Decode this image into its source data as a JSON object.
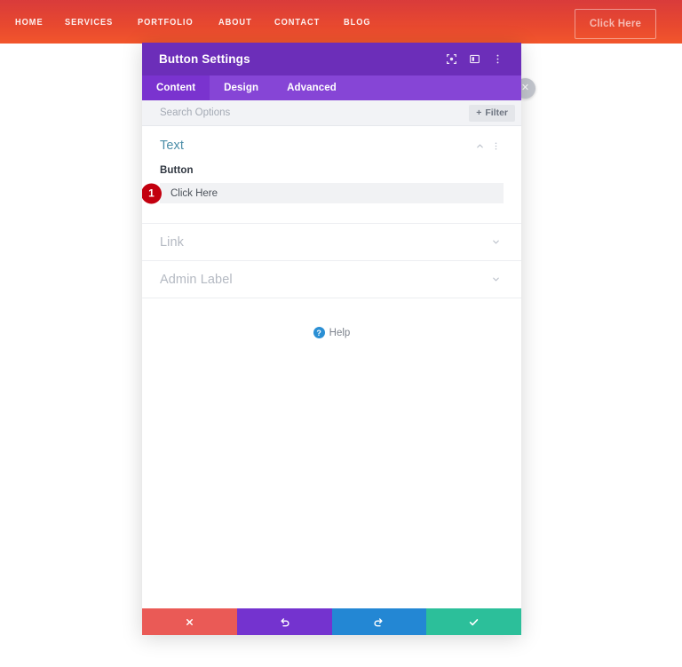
{
  "site": {
    "nav": [
      {
        "label": "HOME"
      },
      {
        "label": "SERVICES"
      },
      {
        "label": "PORTFOLIO"
      },
      {
        "label": "ABOUT"
      },
      {
        "label": "CONTACT"
      },
      {
        "label": "BLOG"
      }
    ],
    "cta_label": "Click Here",
    "header_gradient_from": "#d93b3b",
    "header_gradient_to": "#f2562c",
    "close_icon": "close-icon"
  },
  "modal": {
    "title": "Button Settings",
    "titlebar_color": "#6c2eb9",
    "title_icons": [
      {
        "name": "focus-target-icon"
      },
      {
        "name": "layout-panel-icon"
      },
      {
        "name": "more-vertical-icon"
      }
    ],
    "tabs": [
      {
        "label": "Content",
        "active": true
      },
      {
        "label": "Design",
        "active": false
      },
      {
        "label": "Advanced",
        "active": false
      }
    ],
    "search": {
      "placeholder": "Search Options",
      "value": "",
      "filter_label": "Filter",
      "filter_icon": "plus-icon"
    },
    "sections": {
      "text": {
        "title": "Text",
        "title_color": "#4c8ea8",
        "collapse_icon": "chevron-up-icon",
        "menu_icon": "more-vertical-icon",
        "field_label": "Button",
        "field_value": "Click Here",
        "badge": "1",
        "badge_color": "#c3000f"
      },
      "link": {
        "title": "Link",
        "expand_icon": "chevron-down-icon"
      },
      "admin_label": {
        "title": "Admin Label",
        "expand_icon": "chevron-down-icon"
      }
    },
    "help": {
      "label": "Help",
      "icon": "question-circle-icon",
      "icon_color": "#2a8fd4"
    },
    "footer": [
      {
        "name": "cancel-button",
        "icon": "close-icon",
        "color": "#ea5a56"
      },
      {
        "name": "undo-button",
        "icon": "undo-icon",
        "color": "#7433cf"
      },
      {
        "name": "redo-button",
        "icon": "redo-icon",
        "color": "#2387d4"
      },
      {
        "name": "save-button",
        "icon": "check-icon",
        "color": "#2cbf9a"
      }
    ]
  }
}
